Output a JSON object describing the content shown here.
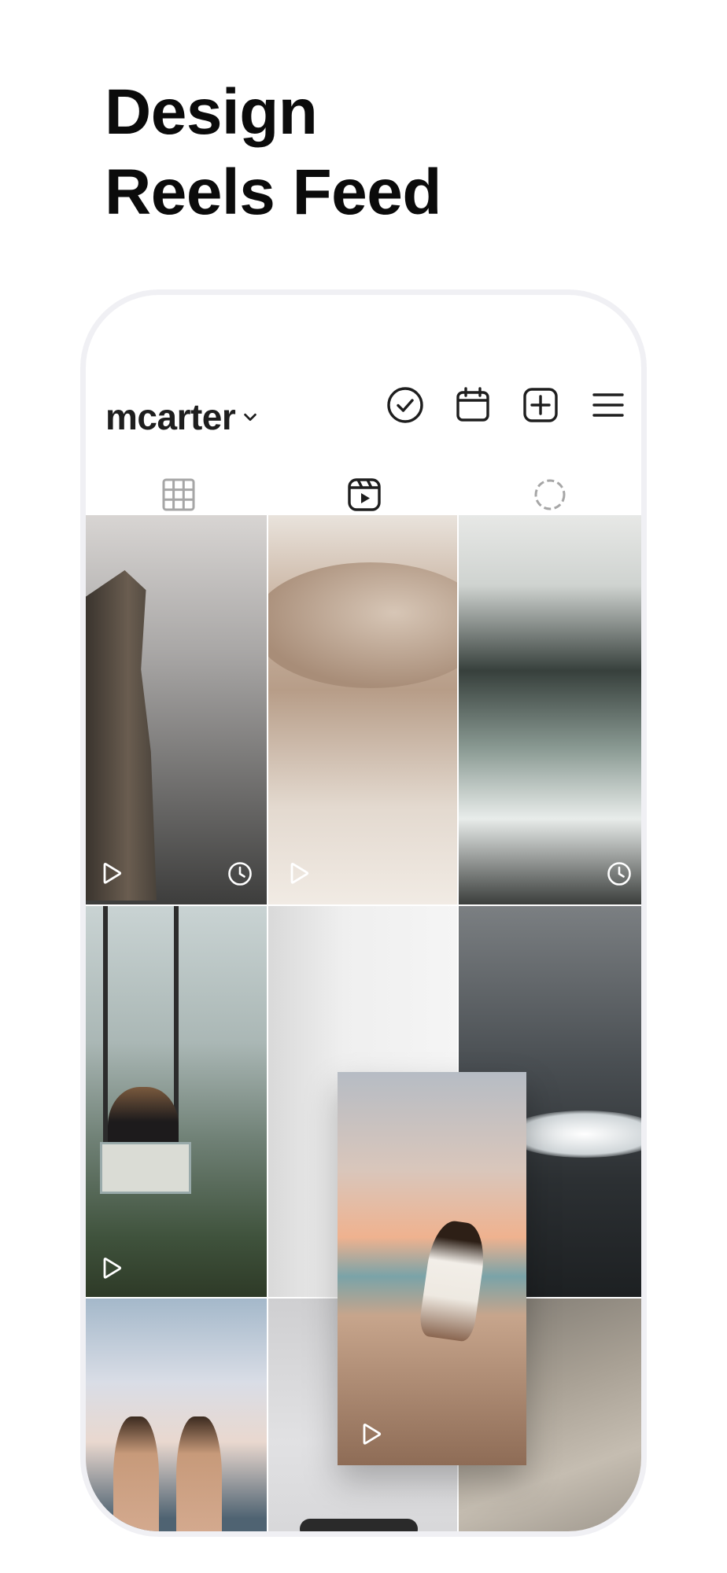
{
  "headline": {
    "line1": "Design",
    "line2": "Reels Feed"
  },
  "profile": {
    "username": "mcarter"
  },
  "icons": {
    "dropdown": "chevron-down-icon",
    "top_bar": [
      "check-circle-icon",
      "calendar-icon",
      "add-square-icon",
      "menu-icon"
    ],
    "tabs": [
      "grid-icon",
      "reels-icon",
      "loading-circle-icon"
    ],
    "tile": [
      "play-icon",
      "clock-icon"
    ]
  },
  "tabs": {
    "active": "reels"
  },
  "colors": {
    "text": "#1e1e1e",
    "frame": "#f0f0f4",
    "active_tab_underline": "#222222",
    "inactive_icon": "#a6a6a6"
  },
  "tiles": [
    {
      "id": 1,
      "scene": "cliff-couple",
      "play": true,
      "scheduled": true
    },
    {
      "id": 2,
      "scene": "desert-wedding",
      "play": true,
      "scheduled": false
    },
    {
      "id": 3,
      "scene": "rocky-coast",
      "play": false,
      "scheduled": true
    },
    {
      "id": 4,
      "scene": "swing-valley",
      "play": true,
      "scheduled": false
    },
    {
      "id": 5,
      "scene": "empty-slot",
      "play": false,
      "scheduled": false
    },
    {
      "id": 6,
      "scene": "dark-wave",
      "play": true,
      "scheduled": false
    },
    {
      "id": 7,
      "scene": "beach-friends",
      "play": false,
      "scheduled": false
    },
    {
      "id": 8,
      "scene": "surfer",
      "play": false,
      "scheduled": false
    },
    {
      "id": 9,
      "scene": "sand-beach",
      "play": false,
      "scheduled": false
    }
  ],
  "dragged_tile": {
    "scene": "beach-runner-sunset",
    "play": true
  }
}
